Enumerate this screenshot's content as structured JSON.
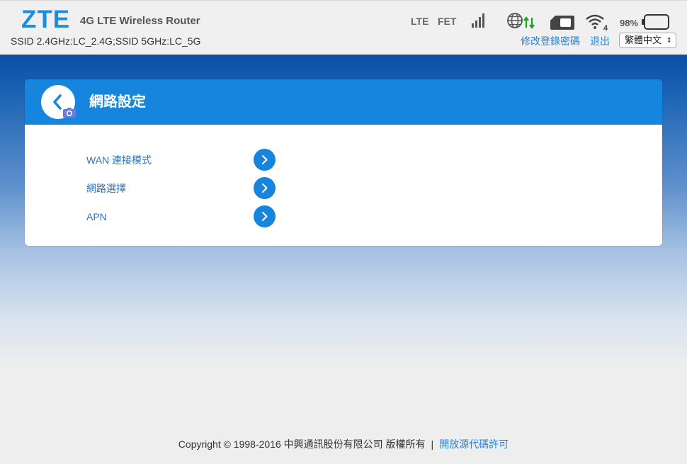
{
  "header": {
    "logo": "ZTE",
    "product": "4G LTE Wireless Router",
    "ssid": "SSID 2.4GHz:LC_2.4G;SSID 5GHz:LC_5G",
    "status": {
      "network_type": "LTE",
      "operator": "FET",
      "signal_bars": 4,
      "wifi_clients": "4",
      "battery_percent": "98%"
    },
    "change_password": "修改登錄密碼",
    "logout": "退出",
    "language": "繁體中文"
  },
  "panel": {
    "title": "網路設定",
    "items": [
      {
        "label": "WAN 連接模式"
      },
      {
        "label": "網路選擇"
      },
      {
        "label": "APN"
      }
    ]
  },
  "footer": {
    "copyright": "Copyright © 1998-2016 中興通訊股份有限公司 版權所有",
    "separator": "|",
    "license": "開放源代碼許可"
  },
  "colors": {
    "brand_blue": "#1b8ee0",
    "panel_header": "#1585dd",
    "link": "#2a7fd0",
    "data_active": "#1aa31a"
  }
}
